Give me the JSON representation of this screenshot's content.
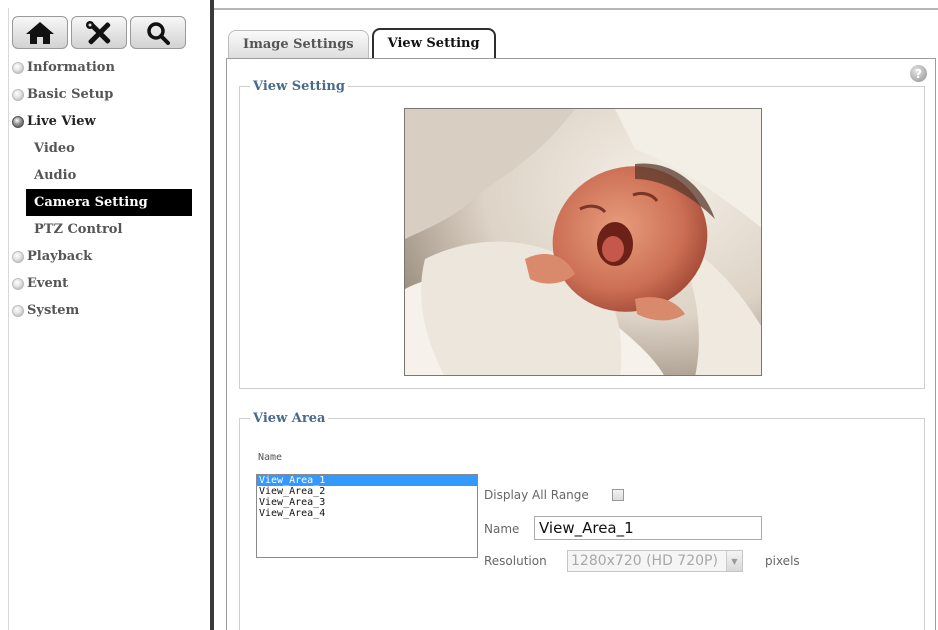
{
  "toolbar": {
    "home_icon": "home-icon",
    "tools_icon": "tools-icon",
    "search_icon": "search-icon"
  },
  "sidebar": {
    "items": [
      {
        "label": "Information"
      },
      {
        "label": "Basic Setup"
      },
      {
        "label": "Live View",
        "expanded": true,
        "children": [
          {
            "label": "Video"
          },
          {
            "label": "Audio"
          },
          {
            "label": "Camera Setting",
            "active": true
          },
          {
            "label": "PTZ Control"
          }
        ]
      },
      {
        "label": "Playback"
      },
      {
        "label": "Event"
      },
      {
        "label": "System"
      }
    ]
  },
  "tabs": [
    {
      "label": "Image Settings"
    },
    {
      "label": "View Setting",
      "active": true
    }
  ],
  "view_setting": {
    "legend": "View Setting"
  },
  "view_area": {
    "legend": "View Area",
    "name_header": "Name",
    "options": [
      "View_Area_1",
      "View_Area_2",
      "View_Area_3",
      "View_Area_4"
    ],
    "selected": "View_Area_1",
    "display_all_range_label": "Display All Range",
    "display_all_range_checked": false,
    "name_label": "Name",
    "name_value": "View_Area_1",
    "resolution_label": "Resolution",
    "resolution_value": "1280x720 (HD 720P)",
    "resolution_unit": "pixels"
  },
  "colors": {
    "legend": "#4a6a8c",
    "active_menu_bg": "#000000",
    "selection": "#3399ff"
  }
}
